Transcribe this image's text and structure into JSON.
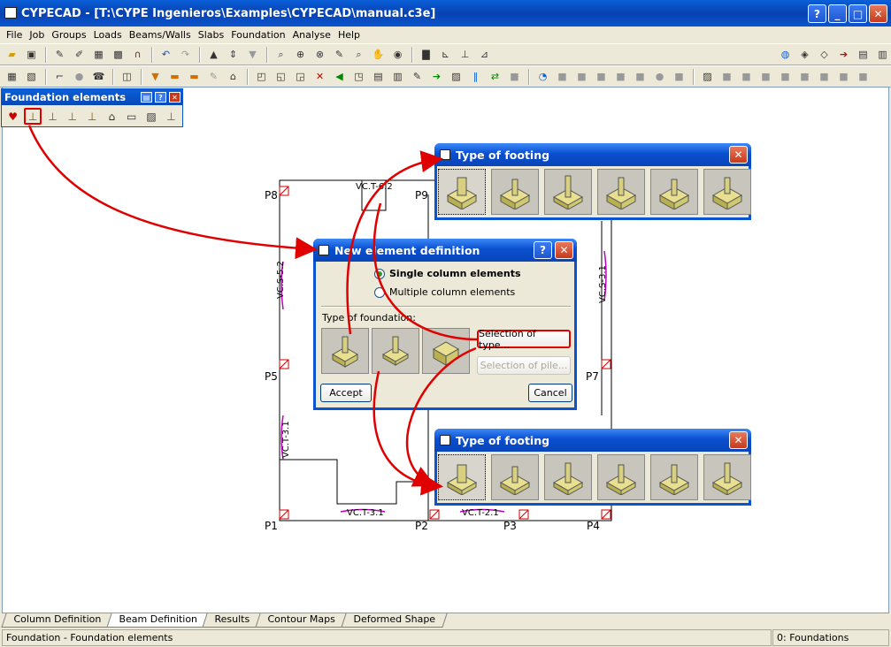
{
  "window": {
    "title": "CYPECAD - [T:\\CYPE Ingenieros\\Examples\\CYPECAD\\manual.c3e]"
  },
  "menu": [
    "File",
    "Job",
    "Groups",
    "Loads",
    "Beams/Walls",
    "Slabs",
    "Foundation",
    "Analyse",
    "Help"
  ],
  "panel": {
    "title": "Foundation elements"
  },
  "columns": [
    "P8",
    "P9",
    "P5",
    "P7",
    "P1",
    "P2",
    "P3",
    "P4"
  ],
  "beams": [
    "VC.T-6.2",
    "VC.S-5.2",
    "VC.S-3.1",
    "VC.T-3.1",
    "VC.T-3.1",
    "VC.T-2.1"
  ],
  "dialog_new": {
    "title": "New element definition",
    "option_single": "Single column elements",
    "option_multiple": "Multiple column elements",
    "type_label": "Type of foundation:",
    "selection_type": "Selection of type...",
    "selection_pile": "Selection of pile...",
    "accept": "Accept",
    "cancel": "Cancel"
  },
  "dialog_type1": {
    "title": "Type of footing"
  },
  "dialog_type2": {
    "title": "Type of footing"
  },
  "tabs": [
    "Column Definition",
    "Beam Definition",
    "Results",
    "Contour Maps",
    "Deformed Shape"
  ],
  "status": {
    "left": "Foundation - Foundation elements",
    "right": "0: Foundations"
  }
}
